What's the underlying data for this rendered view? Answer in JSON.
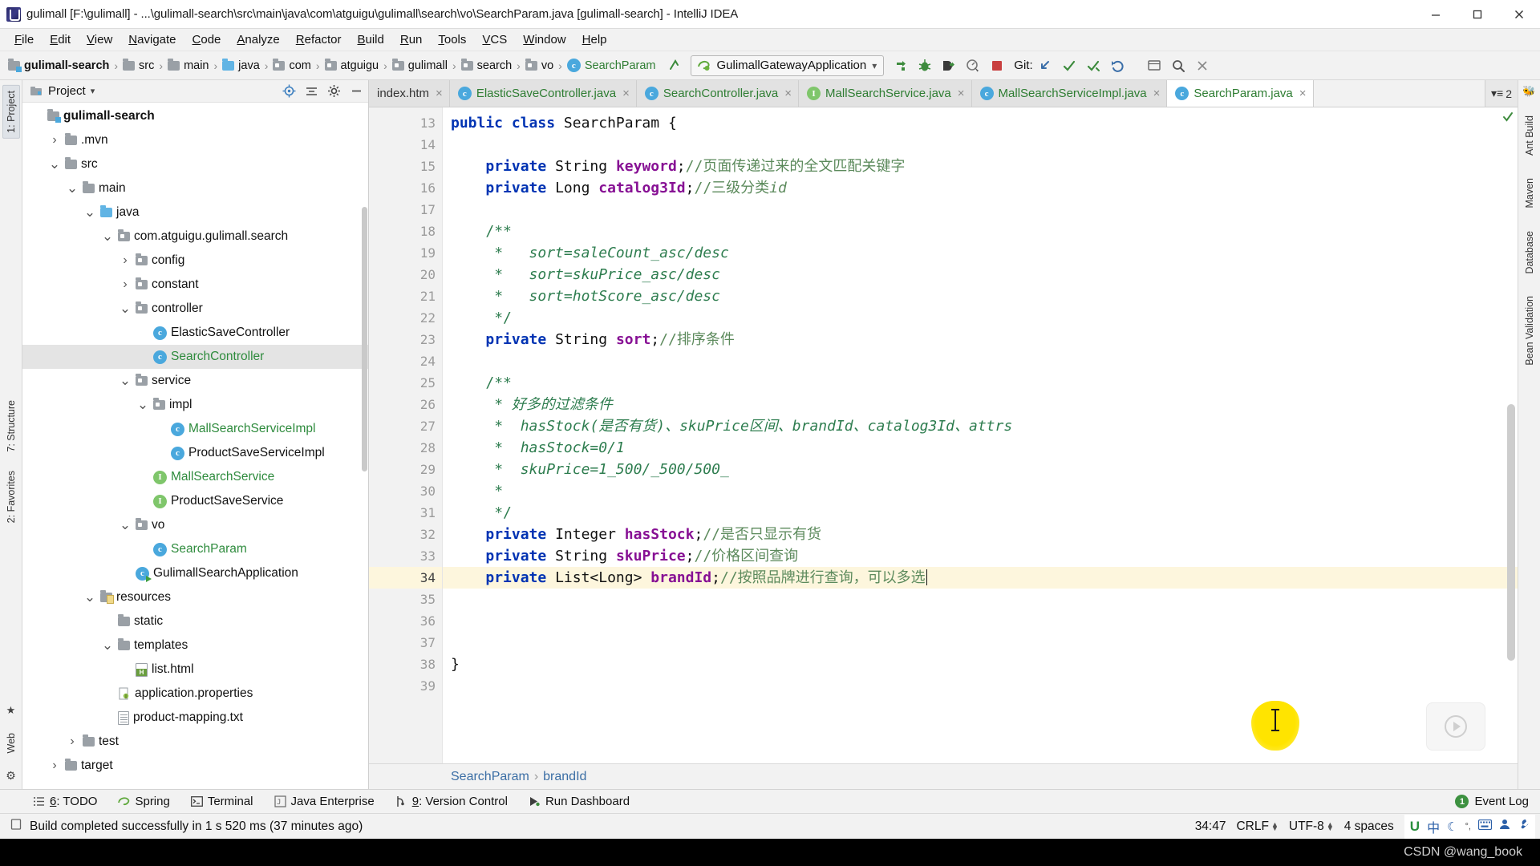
{
  "window": {
    "title": "gulimall [F:\\gulimall] - ...\\gulimall-search\\src\\main\\java\\com\\atguigu\\gulimall\\search\\vo\\SearchParam.java [gulimall-search] - IntelliJ IDEA",
    "minimize_label": "Minimize",
    "maximize_label": "Maximize",
    "close_label": "Close"
  },
  "menubar": {
    "items": [
      "File",
      "Edit",
      "View",
      "Navigate",
      "Code",
      "Analyze",
      "Refactor",
      "Build",
      "Run",
      "Tools",
      "VCS",
      "Window",
      "Help"
    ]
  },
  "navbar": {
    "breadcrumbs": [
      {
        "label": "gulimall-search",
        "icon": "module-folder-icon",
        "type": "module"
      },
      {
        "label": "src",
        "icon": "folder-icon",
        "type": "folder"
      },
      {
        "label": "main",
        "icon": "folder-icon",
        "type": "folder"
      },
      {
        "label": "java",
        "icon": "source-folder-icon",
        "type": "source"
      },
      {
        "label": "com",
        "icon": "package-icon",
        "type": "package"
      },
      {
        "label": "atguigu",
        "icon": "package-icon",
        "type": "package"
      },
      {
        "label": "gulimall",
        "icon": "package-icon",
        "type": "package"
      },
      {
        "label": "search",
        "icon": "package-icon",
        "type": "package"
      },
      {
        "label": "vo",
        "icon": "package-icon",
        "type": "package"
      },
      {
        "label": "SearchParam",
        "icon": "class-icon",
        "type": "class"
      }
    ],
    "run_configuration": "GulimallGatewayApplication",
    "git_label": "Git:",
    "toolbar_icons": [
      "run-icon",
      "debug-icon",
      "run-with-coverage-icon",
      "profile-icon",
      "stop-icon"
    ],
    "git_icons": [
      "update-project-icon",
      "commit-icon",
      "push-icon",
      "rollback-icon"
    ],
    "right_icons": [
      "search-everywhere-icon",
      "settings-icon",
      "help-icon"
    ]
  },
  "project_panel": {
    "title": "Project",
    "dropdown_icon": "chevron-down-icon",
    "actions": [
      "locate-icon",
      "collapse-all-icon",
      "settings-icon",
      "hide-icon"
    ],
    "tree": [
      {
        "label": "gulimall-search",
        "indent": 0,
        "twist": "",
        "icon": "module-folder-icon",
        "bold": true,
        "selected": false,
        "color": "default"
      },
      {
        "label": ".mvn",
        "indent": 1,
        "twist": "collapsed",
        "icon": "folder-icon",
        "bold": false,
        "selected": false,
        "color": "default"
      },
      {
        "label": "src",
        "indent": 1,
        "twist": "expanded",
        "icon": "folder-icon",
        "bold": false,
        "selected": false,
        "color": "default"
      },
      {
        "label": "main",
        "indent": 2,
        "twist": "expanded",
        "icon": "folder-icon",
        "bold": false,
        "selected": false,
        "color": "default"
      },
      {
        "label": "java",
        "indent": 3,
        "twist": "expanded",
        "icon": "source-folder-icon",
        "bold": false,
        "selected": false,
        "color": "default"
      },
      {
        "label": "com.atguigu.gulimall.search",
        "indent": 4,
        "twist": "expanded",
        "icon": "package-icon",
        "bold": false,
        "selected": false,
        "color": "default"
      },
      {
        "label": "config",
        "indent": 5,
        "twist": "collapsed",
        "icon": "package-icon",
        "bold": false,
        "selected": false,
        "color": "default"
      },
      {
        "label": "constant",
        "indent": 5,
        "twist": "collapsed",
        "icon": "package-icon",
        "bold": false,
        "selected": false,
        "color": "default"
      },
      {
        "label": "controller",
        "indent": 5,
        "twist": "expanded",
        "icon": "package-icon",
        "bold": false,
        "selected": false,
        "color": "default"
      },
      {
        "label": "ElasticSaveController",
        "indent": 6,
        "twist": "",
        "icon": "class-icon",
        "bold": false,
        "selected": false,
        "color": "default"
      },
      {
        "label": "SearchController",
        "indent": 6,
        "twist": "",
        "icon": "class-icon",
        "bold": false,
        "selected": true,
        "color": "green"
      },
      {
        "label": "service",
        "indent": 5,
        "twist": "expanded",
        "icon": "package-icon",
        "bold": false,
        "selected": false,
        "color": "default"
      },
      {
        "label": "impl",
        "indent": 6,
        "twist": "expanded",
        "icon": "package-icon",
        "bold": false,
        "selected": false,
        "color": "default"
      },
      {
        "label": "MallSearchServiceImpl",
        "indent": 7,
        "twist": "",
        "icon": "class-icon",
        "bold": false,
        "selected": false,
        "color": "green"
      },
      {
        "label": "ProductSaveServiceImpl",
        "indent": 7,
        "twist": "",
        "icon": "class-icon",
        "bold": false,
        "selected": false,
        "color": "default"
      },
      {
        "label": "MallSearchService",
        "indent": 6,
        "twist": "",
        "icon": "interface-icon",
        "bold": false,
        "selected": false,
        "color": "green"
      },
      {
        "label": "ProductSaveService",
        "indent": 6,
        "twist": "",
        "icon": "interface-icon",
        "bold": false,
        "selected": false,
        "color": "default"
      },
      {
        "label": "vo",
        "indent": 5,
        "twist": "expanded",
        "icon": "package-icon",
        "bold": false,
        "selected": false,
        "color": "default"
      },
      {
        "label": "SearchParam",
        "indent": 6,
        "twist": "",
        "icon": "class-icon",
        "bold": false,
        "selected": false,
        "color": "green"
      },
      {
        "label": "GulimallSearchApplication",
        "indent": 5,
        "twist": "",
        "icon": "spring-app-icon",
        "bold": false,
        "selected": false,
        "color": "default"
      },
      {
        "label": "resources",
        "indent": 3,
        "twist": "expanded",
        "icon": "resources-folder-icon",
        "bold": false,
        "selected": false,
        "color": "default"
      },
      {
        "label": "static",
        "indent": 4,
        "twist": "",
        "icon": "folder-icon",
        "bold": false,
        "selected": false,
        "color": "default"
      },
      {
        "label": "templates",
        "indent": 4,
        "twist": "expanded",
        "icon": "folder-icon",
        "bold": false,
        "selected": false,
        "color": "default"
      },
      {
        "label": "list.html",
        "indent": 5,
        "twist": "",
        "icon": "html-file-icon",
        "bold": false,
        "selected": false,
        "color": "default"
      },
      {
        "label": "application.properties",
        "indent": 4,
        "twist": "",
        "icon": "properties-file-icon",
        "bold": false,
        "selected": false,
        "color": "default"
      },
      {
        "label": "product-mapping.txt",
        "indent": 4,
        "twist": "",
        "icon": "text-file-icon",
        "bold": false,
        "selected": false,
        "color": "default"
      },
      {
        "label": "test",
        "indent": 2,
        "twist": "collapsed",
        "icon": "folder-icon",
        "bold": false,
        "selected": false,
        "color": "default"
      },
      {
        "label": "target",
        "indent": 1,
        "twist": "collapsed",
        "icon": "folder-icon",
        "bold": false,
        "selected": false,
        "color": "default"
      }
    ]
  },
  "left_strip": {
    "tabs": [
      "1: Project",
      "7: Structure",
      "2: Favorites"
    ],
    "bottom": [
      "Web"
    ]
  },
  "right_strip": {
    "tabs": [
      "Ant Build",
      "Maven",
      "Database",
      "Bean Validation"
    ]
  },
  "editor_tabs": {
    "tabs": [
      {
        "label": "index.htm",
        "icon": "html-file-icon",
        "active": false,
        "color": "plain"
      },
      {
        "label": "ElasticSaveController.java",
        "icon": "class-icon",
        "active": false,
        "color": "green"
      },
      {
        "label": "SearchController.java",
        "icon": "class-icon",
        "active": false,
        "color": "green"
      },
      {
        "label": "MallSearchService.java",
        "icon": "interface-icon",
        "active": false,
        "color": "green"
      },
      {
        "label": "MallSearchServiceImpl.java",
        "icon": "class-icon",
        "active": false,
        "color": "green"
      },
      {
        "label": "SearchParam.java",
        "icon": "class-icon",
        "active": true,
        "color": "green"
      }
    ],
    "overflow_count": "2",
    "close_glyph": "×"
  },
  "editor": {
    "first_line": 13,
    "current_line": 34,
    "lines": [
      {
        "n": 13,
        "fold": false,
        "bulb": false,
        "html": "<span class=\"kw\">public class</span> <span class=\"typ\">SearchParam</span> {"
      },
      {
        "n": 14,
        "fold": false,
        "bulb": false,
        "html": ""
      },
      {
        "n": 15,
        "fold": false,
        "bulb": false,
        "html": "    <span class=\"kw\">private</span> <span class=\"typ\">String</span> <span class=\"fld\">keyword</span>;<span class=\"cmz\">//页面传递过来的全文匹配关键字</span>"
      },
      {
        "n": 16,
        "fold": false,
        "bulb": false,
        "html": "    <span class=\"kw\">private</span> <span class=\"typ\">Long</span> <span class=\"fld\">catalog3Id</span>;<span class=\"cmz\">//三级分类<i>id</i></span>"
      },
      {
        "n": 17,
        "fold": false,
        "bulb": false,
        "html": ""
      },
      {
        "n": 18,
        "fold": true,
        "bulb": false,
        "html": "    <span class=\"docb\">/**</span>"
      },
      {
        "n": 19,
        "fold": false,
        "bulb": false,
        "html": "     <span class=\"docb\">*</span>   <span class=\"doc\">sort=saleCount_asc/desc</span>"
      },
      {
        "n": 20,
        "fold": false,
        "bulb": false,
        "html": "     <span class=\"docb\">*</span>   <span class=\"doc\">sort=skuPrice_asc/desc</span>"
      },
      {
        "n": 21,
        "fold": false,
        "bulb": false,
        "html": "     <span class=\"docb\">*</span>   <span class=\"doc\">sort=hotScore_asc/desc</span>"
      },
      {
        "n": 22,
        "fold": true,
        "bulb": false,
        "html": "     <span class=\"docb\">*/</span>"
      },
      {
        "n": 23,
        "fold": false,
        "bulb": false,
        "html": "    <span class=\"kw\">private</span> <span class=\"typ\">String</span> <span class=\"fld\">sort</span>;<span class=\"cmz\">//排序条件</span>"
      },
      {
        "n": 24,
        "fold": false,
        "bulb": false,
        "html": ""
      },
      {
        "n": 25,
        "fold": true,
        "bulb": false,
        "html": "    <span class=\"docb\">/**</span>"
      },
      {
        "n": 26,
        "fold": false,
        "bulb": false,
        "html": "     <span class=\"docb\">*</span> <span class=\"doc\">好多的过滤条件</span>"
      },
      {
        "n": 27,
        "fold": false,
        "bulb": false,
        "html": "     <span class=\"docb\">*</span>  <span class=\"doc\">hasStock(是否有货)、skuPrice区间、brandId、catalog3Id、attrs</span>"
      },
      {
        "n": 28,
        "fold": false,
        "bulb": false,
        "html": "     <span class=\"docb\">*</span>  <span class=\"doc\">hasStock=0/1</span>"
      },
      {
        "n": 29,
        "fold": false,
        "bulb": false,
        "html": "     <span class=\"docb\">*</span>  <span class=\"doc\">skuPrice=1_500/_500/500_</span>"
      },
      {
        "n": 30,
        "fold": false,
        "bulb": false,
        "html": "     <span class=\"docb\">*</span>"
      },
      {
        "n": 31,
        "fold": true,
        "bulb": false,
        "html": "     <span class=\"docb\">*/</span>"
      },
      {
        "n": 32,
        "fold": false,
        "bulb": false,
        "html": "    <span class=\"kw\">private</span> <span class=\"typ\">Integer</span> <span class=\"fld\">hasStock</span>;<span class=\"cmz\">//是否只显示有货</span>"
      },
      {
        "n": 33,
        "fold": false,
        "bulb": false,
        "html": "    <span class=\"kw\">private</span> <span class=\"typ\">String</span> <span class=\"fld\">skuPrice</span>;<span class=\"cmz\">//价格区间查询</span>"
      },
      {
        "n": 34,
        "fold": false,
        "bulb": true,
        "html": "    <span class=\"kw\">private</span> <span class=\"typ\">List&lt;Long&gt;</span> <span class=\"fld\">brandId</span>;<span class=\"cmz\">//按照品牌进行查询，可以多选</span><span class=\"caret\"></span>"
      },
      {
        "n": 35,
        "fold": false,
        "bulb": false,
        "html": ""
      },
      {
        "n": 36,
        "fold": false,
        "bulb": false,
        "html": ""
      },
      {
        "n": 37,
        "fold": false,
        "bulb": false,
        "html": ""
      },
      {
        "n": 38,
        "fold": false,
        "bulb": false,
        "html": "}"
      },
      {
        "n": 39,
        "fold": false,
        "bulb": false,
        "html": ""
      }
    ],
    "breadcrumb": [
      "SearchParam",
      "brandId"
    ],
    "breadcrumb_sep": "›"
  },
  "tool_window_bar": {
    "items": [
      {
        "label": "6: TODO",
        "icon": "todo-icon",
        "mnemonic": "6"
      },
      {
        "label": "Spring",
        "icon": "spring-icon",
        "mnemonic": ""
      },
      {
        "label": "Terminal",
        "icon": "terminal-icon",
        "mnemonic": ""
      },
      {
        "label": "Java Enterprise",
        "icon": "java-enterprise-icon",
        "mnemonic": ""
      },
      {
        "label": "9: Version Control",
        "icon": "version-control-icon",
        "mnemonic": "9"
      },
      {
        "label": "Run Dashboard",
        "icon": "run-dashboard-icon",
        "mnemonic": ""
      }
    ],
    "event_log": {
      "label": "Event Log",
      "badge": "1"
    }
  },
  "statusbar": {
    "message": "Build completed successfully in 1 s 520 ms (37 minutes ago)",
    "message_icon": "build-icon",
    "caret_position": "34:47",
    "line_separator": "CRLF",
    "encoding": "UTF-8",
    "indent": "4 spaces",
    "tray_icons": [
      "ime-u-icon",
      "chinese-ime-icon",
      "moon-icon",
      "degree-icon",
      "keyboard-icon",
      "user-icon",
      "wrench-icon"
    ]
  },
  "watermark": "CSDN @wang_book"
}
